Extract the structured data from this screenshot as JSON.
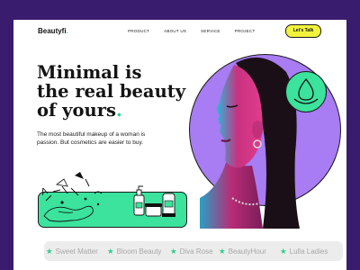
{
  "nav": {
    "logo": "Beautyfi",
    "logo_dot": ".",
    "items": [
      "PRODUCT",
      "ABOUT US",
      "SERVICE",
      "PROJECT"
    ],
    "cta": "Let's Talk"
  },
  "hero": {
    "headline_line1": "Minimal is",
    "headline_line2": "the real beauty",
    "headline_line3": "of yours",
    "headline_dot": ".",
    "description": "The most beautiful makeup of a woman is passion. But cosmetics are easier to buy."
  },
  "brands": [
    {
      "name": "Sweet Matter",
      "icon": "star-icon"
    },
    {
      "name": "Bloom Beauty",
      "icon": "star-icon"
    },
    {
      "name": "Diva Rose",
      "icon": "star-icon"
    },
    {
      "name": "BeautyHour",
      "icon": "star-icon"
    },
    {
      "name": "Lulla Ladies",
      "icon": "star-icon"
    }
  ],
  "colors": {
    "background": "#3a1c6e",
    "accent_green": "#3be39d",
    "accent_purple": "#a87cf2",
    "cta_yellow": "#f2f23c",
    "magenta": "#d2308a",
    "cyan": "#35b9d8"
  },
  "icons": {
    "badge": "water-drop-icon",
    "promo": "cosmetics-illustration"
  }
}
